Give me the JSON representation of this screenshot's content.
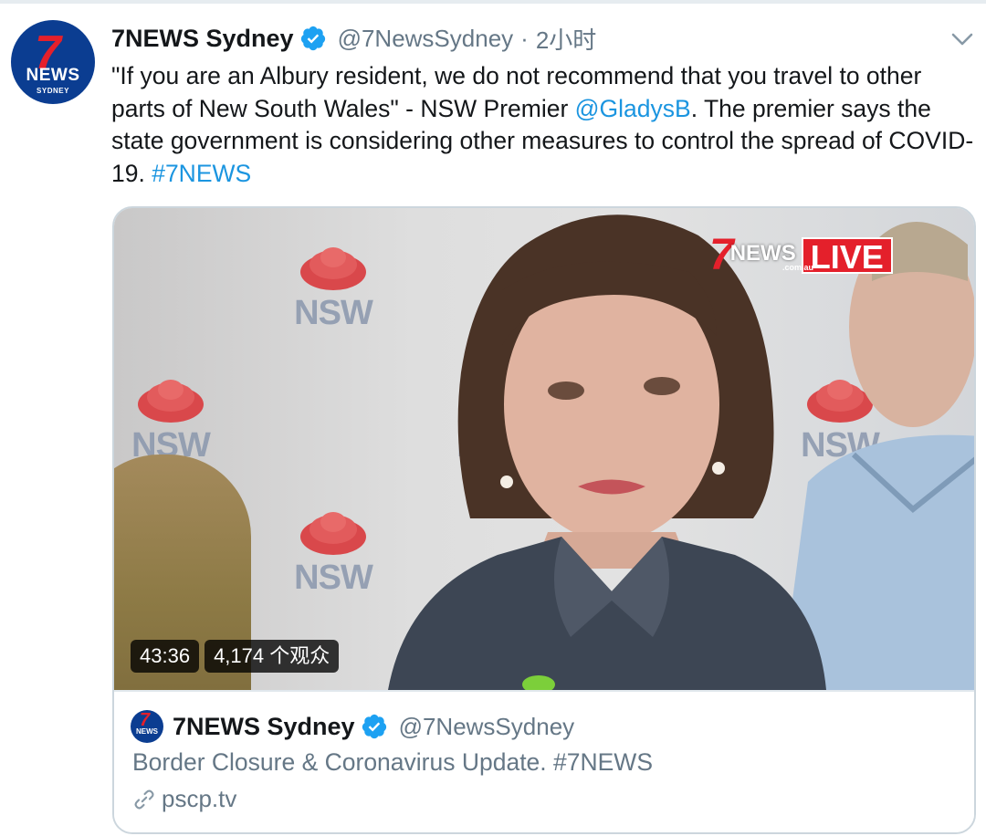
{
  "tweet": {
    "author": {
      "name": "7NEWS Sydney",
      "handle": "@7NewsSydney",
      "avatar_text": {
        "seven": "7",
        "news": "NEWS",
        "city": "SYDNEY"
      }
    },
    "separator": "·",
    "time": "2小时",
    "text": {
      "part1": "\"If you are an Albury resident, we do not recommend that you travel to other parts of New South Wales\" - NSW Premier ",
      "mention": "@GladysB",
      "part2": ". The premier says the state government is considering other measures to control the spread of COVID-19. ",
      "hashtag": "#7NEWS"
    }
  },
  "card": {
    "video": {
      "duration": "43:36",
      "viewers": "4,174 个观众",
      "overlay": {
        "seven": "7",
        "news": "NEWS",
        "domain": ".com.au",
        "live": "LIVE"
      },
      "wall_logo_text": "NSW"
    },
    "author": {
      "name": "7NEWS Sydney",
      "handle": "@7NewsSydney",
      "avatar_seven": "7",
      "avatar_news": "NEWS"
    },
    "title": "Border Closure & Coronavirus Update. #7NEWS",
    "domain": "pscp.tv"
  },
  "colors": {
    "link": "#1b95e0",
    "secondary_text": "#657786",
    "verified": "#1da1f2",
    "live_red": "#e4202b",
    "avatar_blue": "#0b3d91"
  },
  "icons": {
    "verified": "verified-badge-icon",
    "caret": "chevron-down-icon",
    "link": "link-icon"
  }
}
